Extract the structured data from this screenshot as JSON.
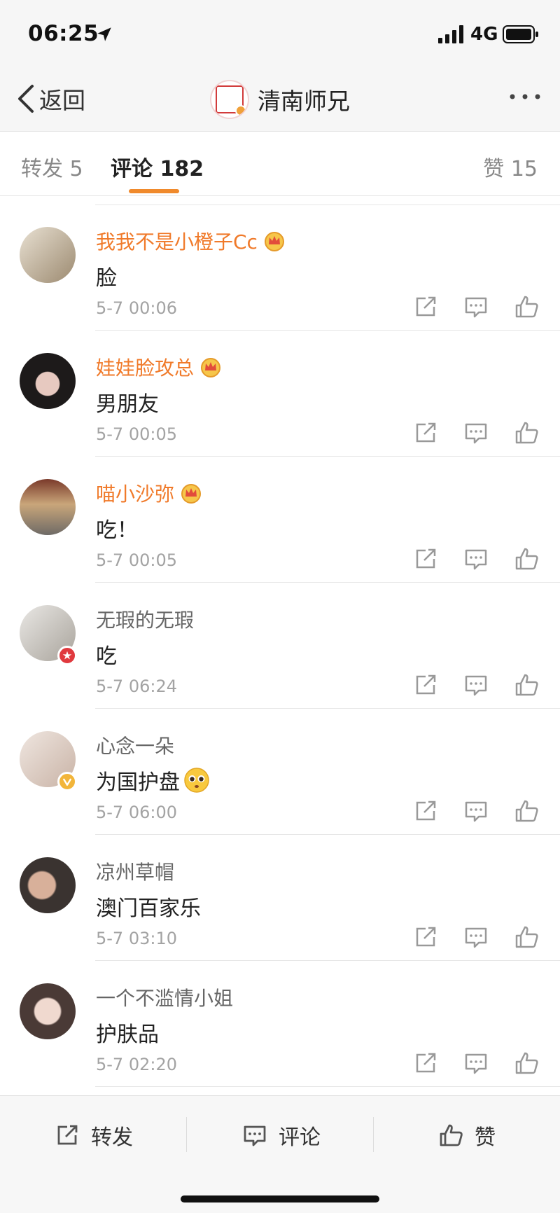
{
  "status_bar": {
    "time": "06:25",
    "network": "4G"
  },
  "nav": {
    "back_label": "返回",
    "title": "清南师兄"
  },
  "tabs": [
    {
      "label": "转发 5"
    },
    {
      "label": "评论 182",
      "active": true
    },
    {
      "label": "赞 15"
    }
  ],
  "comments": [
    {
      "name": "我我不是小橙子Cc",
      "vip": true,
      "text": "脸",
      "time": "5-7 00:06"
    },
    {
      "name": "娃娃脸攻总",
      "vip": true,
      "text": "男朋友",
      "time": "5-7 00:05"
    },
    {
      "name": "喵小沙弥",
      "vip": true,
      "text": "吃！",
      "time": "5-7 00:05"
    },
    {
      "name": "无瑕的无瑕",
      "vip": false,
      "text": "吃",
      "time": "5-7 06:24"
    },
    {
      "name": "心念一朵",
      "vip": false,
      "text": "为国护盘",
      "time": "5-7 06:00"
    },
    {
      "name": "凉州草帽",
      "vip": false,
      "text": "澳门百家乐",
      "time": "5-7 03:10"
    },
    {
      "name": "一个不滥情小姐",
      "vip": false,
      "text": "护肤品",
      "time": "5-7 02:20"
    }
  ],
  "bottom_bar": {
    "repost": "转发",
    "comment": "评论",
    "like": "赞"
  },
  "colors": {
    "accent": "#f08a2c",
    "vip_name": "#f07a2a",
    "muted": "#a3a3a3"
  }
}
